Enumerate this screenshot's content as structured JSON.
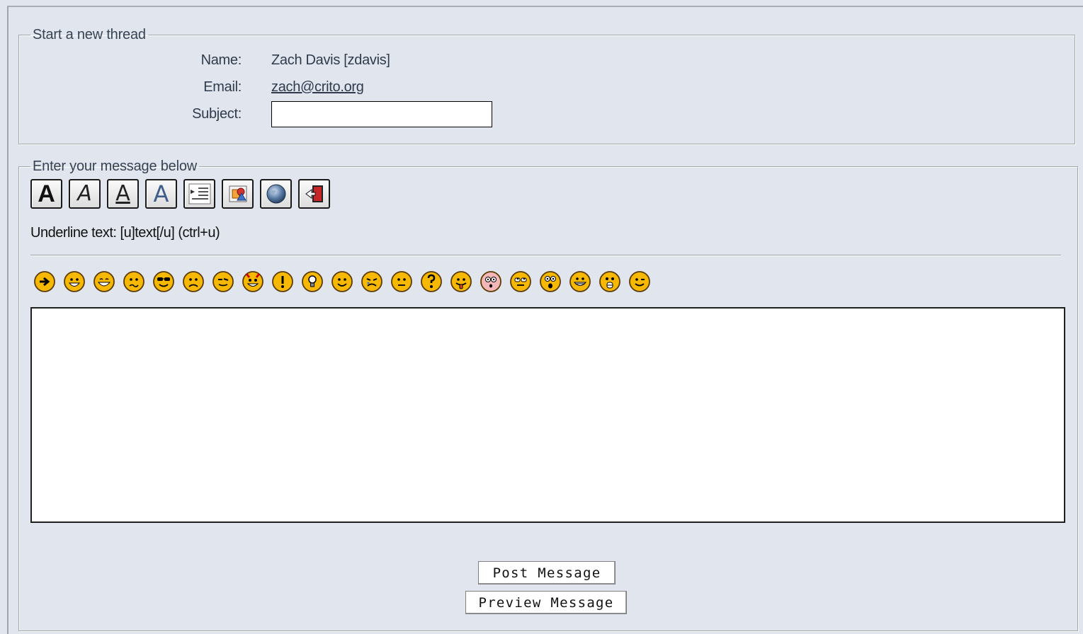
{
  "thread_section": {
    "legend": "Start a new thread",
    "name_label": "Name:",
    "name_value": "Zach Davis [zdavis]",
    "email_label": "Email:",
    "email_value": "zach@crito.org",
    "subject_label": "Subject:",
    "subject_value": ""
  },
  "message_section": {
    "legend": "Enter your message below",
    "toolbar": [
      {
        "name": "bold-button",
        "glyph": "A",
        "icon": "bold-icon"
      },
      {
        "name": "italic-button",
        "glyph": "A",
        "icon": "italic-icon"
      },
      {
        "name": "underline-button",
        "glyph": "A",
        "icon": "underline-icon"
      },
      {
        "name": "color-button",
        "glyph": "A",
        "icon": "color-text-icon"
      },
      {
        "name": "indent-button",
        "icon": "indent-icon"
      },
      {
        "name": "image-button",
        "icon": "image-icon"
      },
      {
        "name": "link-button",
        "icon": "globe-icon"
      },
      {
        "name": "exit-button",
        "icon": "exit-door-icon"
      }
    ],
    "helpline": "Underline text: [u]text[/u]  (ctrl+u)",
    "smilies": [
      "arrow",
      "biggrin",
      "grin",
      "confused",
      "cool",
      "sad",
      "wink-eye",
      "evil",
      "exclaim",
      "idea",
      "smile",
      "cry",
      "neutral",
      "question",
      "razz",
      "redface",
      "rolleyes",
      "surprised",
      "happy",
      "eek",
      "wink"
    ],
    "message_value": "",
    "post_label": "Post Message",
    "preview_label": "Preview Message"
  },
  "colors": {
    "background": "#e1e6ee",
    "smiley_fill": "#f6b800",
    "smiley_outline": "#5a3a00"
  }
}
